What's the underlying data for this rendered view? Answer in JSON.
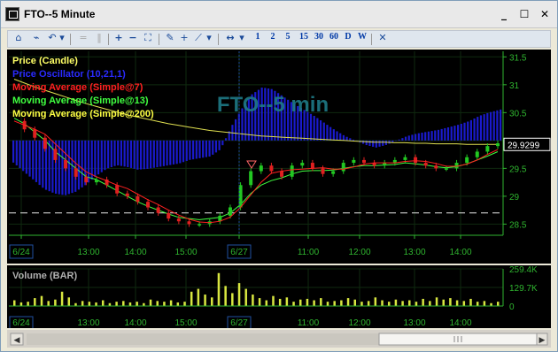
{
  "window": {
    "title": "FTO--5 Minute",
    "buttons": [
      {
        "name": "minimize-button",
        "glyph": "_"
      },
      {
        "name": "maximize-button",
        "glyph": "☐"
      },
      {
        "name": "close-button",
        "glyph": "✕"
      }
    ]
  },
  "toolbar": {
    "icons": [
      {
        "name": "symbol-icon",
        "glyph": "⌂"
      },
      {
        "name": "chart-type-icon",
        "glyph": "⌁"
      },
      {
        "name": "undo-icon",
        "glyph": "↶"
      },
      {
        "name": "dropdown-icon",
        "glyph": "▾"
      },
      {
        "name": "equals-icon",
        "glyph": "="
      },
      {
        "name": "pause-icon",
        "glyph": "‖"
      },
      {
        "name": "zoom-in-icon",
        "glyph": "+"
      },
      {
        "name": "zoom-out-icon",
        "glyph": "−"
      },
      {
        "name": "fit-icon",
        "glyph": "⛶"
      },
      {
        "name": "draw-pencil-icon",
        "glyph": "✎"
      },
      {
        "name": "crosshair-icon",
        "glyph": "+"
      },
      {
        "name": "trendline-icon",
        "glyph": "⟋"
      },
      {
        "name": "dropdown2-icon",
        "glyph": "▾"
      },
      {
        "name": "scroll-icon",
        "glyph": "↔"
      },
      {
        "name": "dropdown3-icon",
        "glyph": "▾"
      }
    ],
    "periods": [
      "1",
      "2",
      "5",
      "15",
      "30",
      "60",
      "D",
      "W"
    ],
    "close_glyph": "✕"
  },
  "colors": {
    "price_line": "#e8e86a",
    "oscillator": "#1a1acc",
    "ma7": "#ff2020",
    "ma13": "#40ff40",
    "ma200": "#e0e050",
    "axis": "#2fb52f",
    "grid": "#0f2a0f",
    "up_candle": "#22c822",
    "down_candle": "#e02020"
  },
  "chart_data": [
    {
      "type": "line",
      "title": "FTO--5 min",
      "legend": [
        {
          "label": "Price (Candle)",
          "color": "#ffff66"
        },
        {
          "label": "Price Oscillator (10,21,1)",
          "color": "#2a2aff"
        },
        {
          "label": "Moving Average (Simple@7)",
          "color": "#ff2020"
        },
        {
          "label": "Moving Average (Simple@13)",
          "color": "#40ff40"
        },
        {
          "label": "Moving Average (Simple@200)",
          "color": "#ffff44"
        }
      ],
      "y_ticks": [
        "31.5",
        "31",
        "30.5",
        "30",
        "29.5",
        "29",
        "28.5"
      ],
      "ylim": [
        28.3,
        31.6
      ],
      "last_price": "29.9299",
      "x_ticks": [
        "6/24",
        "13:00",
        "14:00",
        "15:00",
        "6/27",
        "11:00",
        "12:00",
        "13:00",
        "14:00"
      ],
      "dashed_level": 28.7,
      "series": [
        {
          "name": "price",
          "values": [
            30.35,
            30.2,
            30.05,
            29.85,
            29.65,
            29.5,
            29.35,
            29.25,
            29.3,
            29.2,
            29.05,
            29.0,
            28.9,
            28.8,
            28.7,
            28.6,
            28.55,
            28.5,
            28.5,
            28.55,
            28.65,
            28.8,
            29.2,
            29.45,
            29.55,
            29.45,
            29.35,
            29.55,
            29.6,
            29.5,
            29.4,
            29.45,
            29.6,
            29.65,
            29.6,
            29.55,
            29.6,
            29.65,
            29.7,
            29.6,
            29.55,
            29.5,
            29.5,
            29.6,
            29.7,
            29.8,
            29.9,
            29.95
          ]
        },
        {
          "name": "ma13",
          "values": [
            30.4,
            30.3,
            30.15,
            30.0,
            29.8,
            29.65,
            29.5,
            29.35,
            29.3,
            29.2,
            29.1,
            29.0,
            28.9,
            28.82,
            28.75,
            28.68,
            28.62,
            28.6,
            28.58,
            28.6,
            28.62,
            28.7,
            28.85,
            29.05,
            29.2,
            29.28,
            29.33,
            29.4,
            29.45,
            29.46,
            29.46,
            29.47,
            29.5,
            29.53,
            29.55,
            29.55,
            29.56,
            29.57,
            29.6,
            29.58,
            29.56,
            29.53,
            29.51,
            29.53,
            29.58,
            29.65,
            29.72,
            29.8
          ]
        },
        {
          "name": "ma200",
          "values": [
            31.1,
            31.03,
            30.96,
            30.9,
            30.84,
            30.78,
            30.72,
            30.66,
            30.61,
            30.56,
            30.51,
            30.46,
            30.42,
            30.38,
            30.34,
            30.3,
            30.27,
            30.24,
            30.21,
            30.18,
            30.16,
            30.14,
            30.12,
            30.1,
            30.08,
            30.07,
            30.06,
            30.05,
            30.04,
            30.03,
            30.02,
            30.01,
            30.0,
            29.99,
            29.98,
            29.97,
            29.97,
            29.96,
            29.96,
            29.95,
            29.95,
            29.94,
            29.94,
            29.94,
            29.93,
            29.93,
            29.93,
            29.93
          ]
        },
        {
          "name": "oscillator",
          "values": [
            -0.25,
            -0.35,
            -0.45,
            -0.55,
            -0.6,
            -0.62,
            -0.58,
            -0.5,
            -0.4,
            -0.32,
            -0.28,
            -0.3,
            -0.33,
            -0.32,
            -0.3,
            -0.28,
            -0.26,
            -0.22,
            -0.2,
            -0.18,
            -0.1,
            0.15,
            0.35,
            0.52,
            0.6,
            0.58,
            0.5,
            0.42,
            0.35,
            0.28,
            0.2,
            0.12,
            0.05,
            0.0,
            -0.05,
            -0.08,
            -0.05,
            0.0,
            0.05,
            0.08,
            0.1,
            0.12,
            0.15,
            0.18,
            0.22,
            0.28,
            0.32,
            0.35
          ]
        }
      ]
    },
    {
      "type": "bar",
      "title": "Volume (BAR)",
      "y_ticks": [
        "259.4K",
        "129.7K",
        "0"
      ],
      "ylim": [
        0,
        259.4
      ],
      "x_ticks": [
        "6/24",
        "13:00",
        "14:00",
        "15:00",
        "6/27",
        "11:00",
        "12:00",
        "13:00",
        "14:00"
      ],
      "values": [
        40,
        25,
        30,
        55,
        70,
        35,
        45,
        100,
        60,
        20,
        35,
        30,
        25,
        40,
        20,
        30,
        35,
        25,
        30,
        20,
        45,
        35,
        30,
        40,
        25,
        30,
        100,
        120,
        80,
        60,
        230,
        140,
        90,
        160,
        120,
        80,
        55,
        40,
        70,
        50,
        60,
        30,
        45,
        50,
        40,
        55,
        30,
        35,
        40,
        55,
        45,
        30,
        35,
        60,
        40,
        30,
        45,
        35,
        40,
        30,
        50,
        35,
        60,
        45,
        55,
        40,
        35,
        50,
        30,
        35,
        20,
        30
      ]
    }
  ]
}
